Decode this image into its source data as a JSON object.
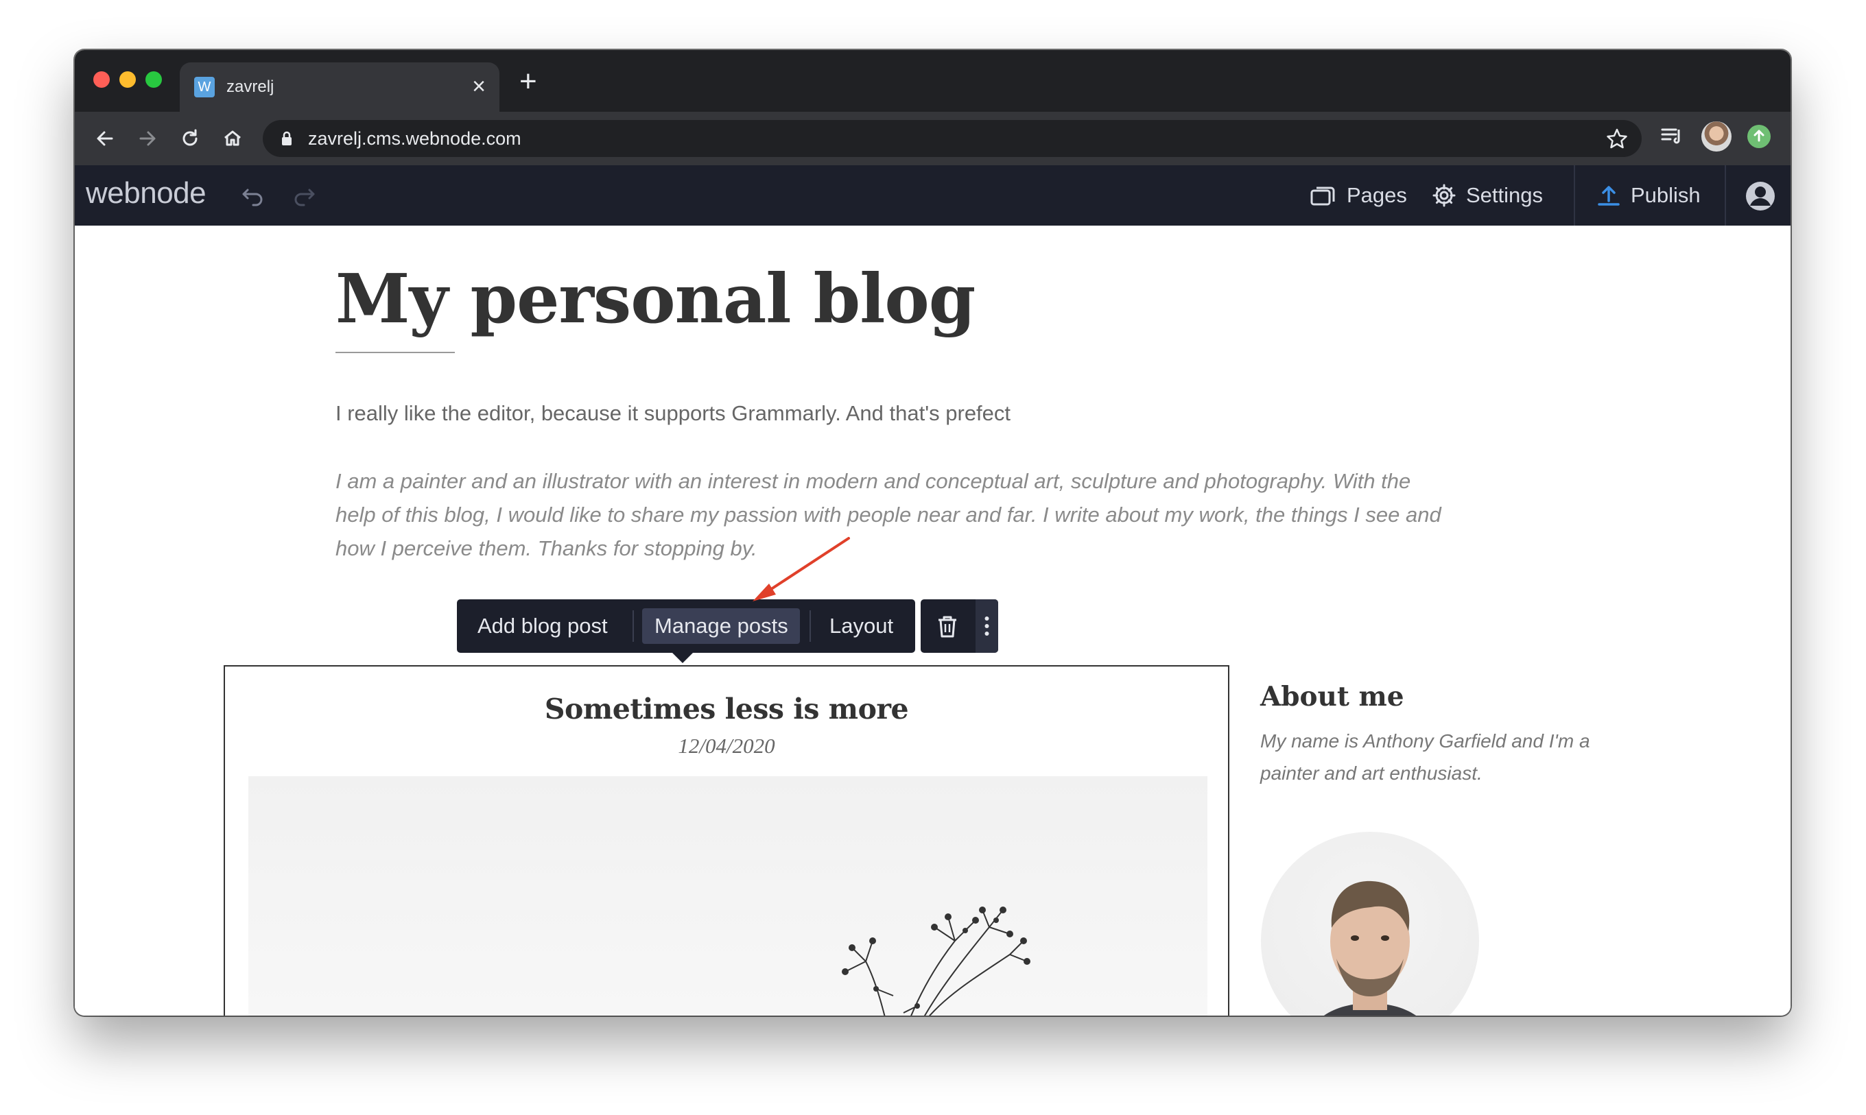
{
  "browser": {
    "tab_title": "zavrelj",
    "favicon_letter": "W",
    "url": "zavrelj.cms.webnode.com",
    "new_tab_label": "+",
    "tab_close_label": "×"
  },
  "appbar": {
    "logo": "webnode",
    "pages_label": "Pages",
    "settings_label": "Settings",
    "publish_label": "Publish"
  },
  "page": {
    "title": "My personal blog",
    "intro": "I really like the editor, because it supports Grammarly. And that's prefect",
    "italic_paragraph": "I am a painter and an illustrator with an interest in modern and conceptual art, sculpture and photography. With the help of this blog, I would like to share my passion with people near and far. I write about my work, the things I see and how I perceive them. Thanks for stopping by."
  },
  "editor_toolbar": {
    "add_post_label": "Add blog post",
    "manage_posts_label": "Manage posts",
    "layout_label": "Layout"
  },
  "post": {
    "title": "Sometimes less is more",
    "date": "12/04/2020"
  },
  "sidebar": {
    "about_title": "About me",
    "about_text": "My name is Anthony Garfield and I'm a painter and art enthusiast."
  },
  "colors": {
    "appbar_bg": "#1c1f2b",
    "publish_icon": "#3b8fe6",
    "annotation_arrow": "#e0402a"
  }
}
